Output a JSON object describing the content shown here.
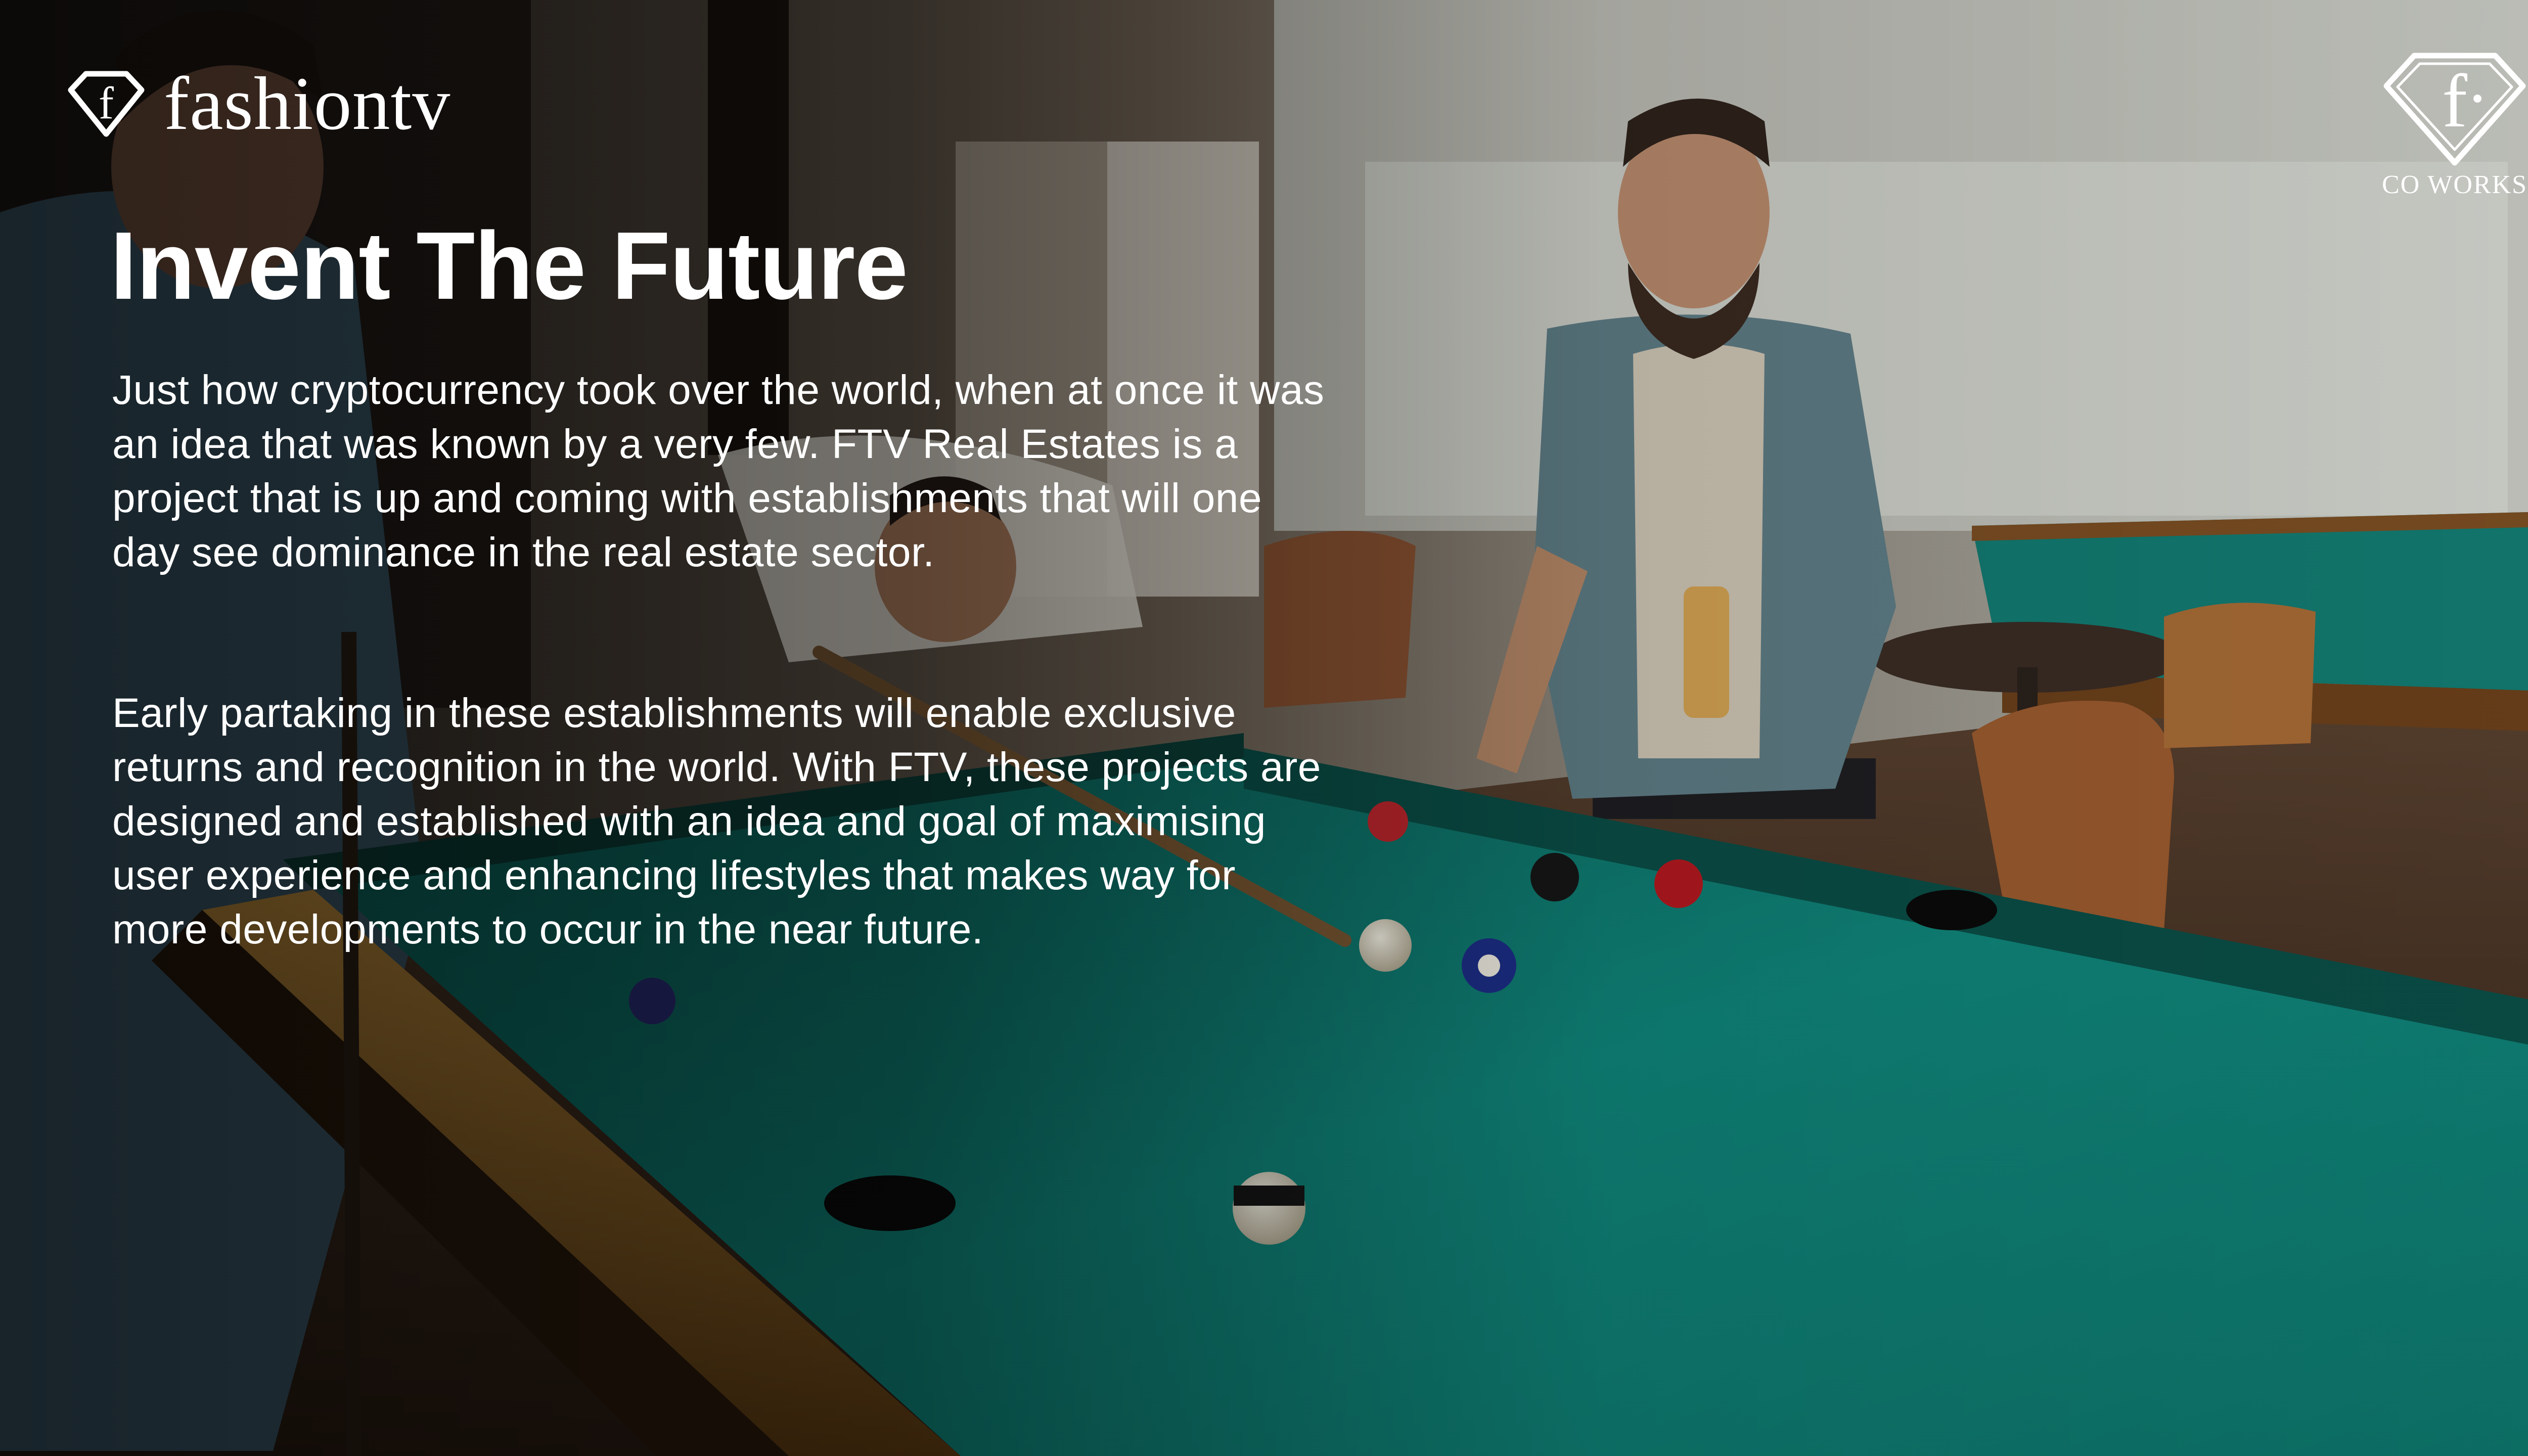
{
  "brand": {
    "wordmark": "fashiontv",
    "logo_icon": "ftv-diamond-icon"
  },
  "corner_badge": {
    "label": "CO WORKS",
    "logo_icon": "ftv-diamond-outline-icon"
  },
  "headline": "Invent The Future",
  "paragraphs": [
    "Just how cryptocurrency took over the world, when at once it was an idea that was known by a very few. FTV Real Estates is a project that is up and coming with establishments that will one day see dominance in the real estate sector.",
    "Early partaking in these establishments will enable exclusive returns and recognition in the world. With FTV, these projects are designed and established with an idea and goal of maximising user experience and enhancing lifestyles that makes way for more developments to occur in the near future."
  ],
  "colors": {
    "text": "#ffffff",
    "table_felt": "#0f7d72",
    "rail": "#b07a2c"
  }
}
